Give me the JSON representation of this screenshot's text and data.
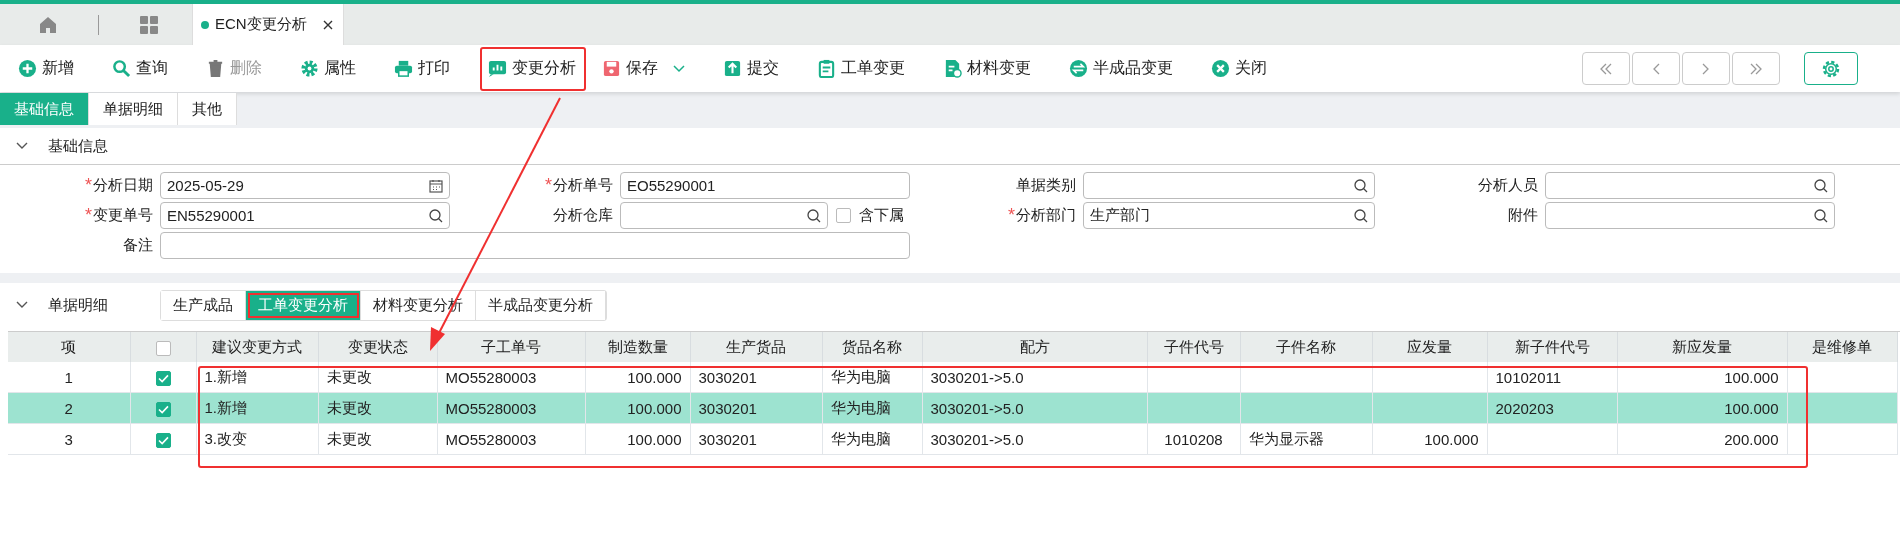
{
  "open_tab": {
    "title": "ECN变更分析",
    "selected": true
  },
  "toolbar": [
    {
      "kind": "add",
      "label": "新增",
      "disabled": false,
      "highlighted": false
    },
    {
      "kind": "search",
      "label": "查询",
      "disabled": false,
      "highlighted": false
    },
    {
      "kind": "delete",
      "label": "删除",
      "disabled": true,
      "highlighted": false
    },
    {
      "kind": "gear",
      "label": "属性",
      "disabled": false,
      "highlighted": false
    },
    {
      "kind": "print",
      "label": "打印",
      "disabled": false,
      "highlighted": false
    },
    {
      "kind": "chart",
      "label": "变更分析",
      "disabled": false,
      "highlighted": true
    },
    {
      "kind": "save",
      "label": "保存",
      "disabled": false,
      "highlighted": false,
      "dropdown": true
    },
    {
      "kind": "upload",
      "label": "提交",
      "disabled": false,
      "highlighted": false
    },
    {
      "kind": "clipboard",
      "label": "工单变更",
      "disabled": false,
      "highlighted": false
    },
    {
      "kind": "document",
      "label": "材料变更",
      "disabled": false,
      "highlighted": false
    },
    {
      "kind": "swap",
      "label": "半成品变更",
      "disabled": false,
      "highlighted": false
    },
    {
      "kind": "close",
      "label": "关闭",
      "disabled": false,
      "highlighted": false
    }
  ],
  "form_tabs": [
    {
      "label": "基础信息",
      "selected": true
    },
    {
      "label": "单据明细",
      "selected": false
    },
    {
      "label": "其他",
      "selected": false
    }
  ],
  "basic_section": {
    "title": "基础信息",
    "expanded": true
  },
  "form_rows": [
    [
      {
        "required_mark": "*",
        "label": "分析日期",
        "kind": "date",
        "value": "2025-05-29"
      },
      {
        "required_mark": "*",
        "label": "分析单号",
        "kind": "text",
        "value": "EO55290001"
      },
      {
        "label": "单据类别",
        "kind": "lookup"
      },
      {
        "label": "分析人员",
        "kind": "lookup"
      }
    ],
    [
      {
        "required_mark": "*",
        "label": "变更单号",
        "kind": "lookup",
        "value": "EN55290001"
      },
      {
        "label": "分析仓库",
        "kind": "lookup",
        "checkbox": {
          "label": "含下属",
          "checked": false
        }
      },
      {
        "required_mark": "*",
        "label": "分析部门",
        "kind": "lookup",
        "value": "生产部门"
      },
      {
        "label": "附件",
        "kind": "lookup"
      }
    ],
    [
      {
        "label": "备注",
        "kind": "wide"
      }
    ]
  ],
  "detail_section": {
    "title": "单据明细",
    "expanded": true,
    "tabs": [
      {
        "label": "生产成品",
        "selected": false,
        "highlighted": false
      },
      {
        "label": "工单变更分析",
        "selected": true,
        "highlighted": true
      },
      {
        "label": "材料变更分析",
        "selected": false,
        "highlighted": false
      },
      {
        "label": "半成品变更分析",
        "selected": false,
        "highlighted": false
      }
    ]
  },
  "table": {
    "rows_highlighted": true,
    "columns": [
      {
        "kind": "text",
        "label": "项"
      },
      {
        "kind": "checkbox",
        "checked": false
      },
      {
        "kind": "text",
        "label": "建议变更方式"
      },
      {
        "kind": "text",
        "label": "变更状态"
      },
      {
        "kind": "text",
        "label": "子工单号"
      },
      {
        "kind": "text",
        "label": "制造数量"
      },
      {
        "kind": "text",
        "label": "生产货品"
      },
      {
        "kind": "text",
        "label": "货品名称"
      },
      {
        "kind": "text",
        "label": "配方"
      },
      {
        "kind": "text",
        "label": "子件代号"
      },
      {
        "kind": "text",
        "label": "子件名称"
      },
      {
        "kind": "text",
        "label": "应发量"
      },
      {
        "kind": "text",
        "label": "新子件代号"
      },
      {
        "kind": "text",
        "label": "新应发量"
      },
      {
        "kind": "text",
        "label": "是维修单"
      }
    ],
    "rows": [
      {
        "selected": false,
        "checked": true,
        "cells": [
          "1",
          null,
          "1.新增",
          "未更改",
          "MO55280003",
          "100.000",
          "3030201",
          "华为电脑",
          "3030201->5.0",
          null,
          null,
          null,
          "10102011",
          "100.000",
          null
        ]
      },
      {
        "selected": true,
        "checked": true,
        "cells": [
          "2",
          null,
          "1.新增",
          "未更改",
          "MO55280003",
          "100.000",
          "3030201",
          "华为电脑",
          "3030201->5.0",
          null,
          null,
          null,
          "2020203",
          "100.000",
          null
        ]
      },
      {
        "selected": false,
        "checked": true,
        "cells": [
          "3",
          null,
          "3.改变",
          "未更改",
          "MO55280003",
          "100.000",
          "3030201",
          "华为电脑",
          "3030201->5.0",
          "1010208",
          "华为显示器",
          "100.000",
          null,
          "200.000",
          null
        ]
      }
    ]
  }
}
